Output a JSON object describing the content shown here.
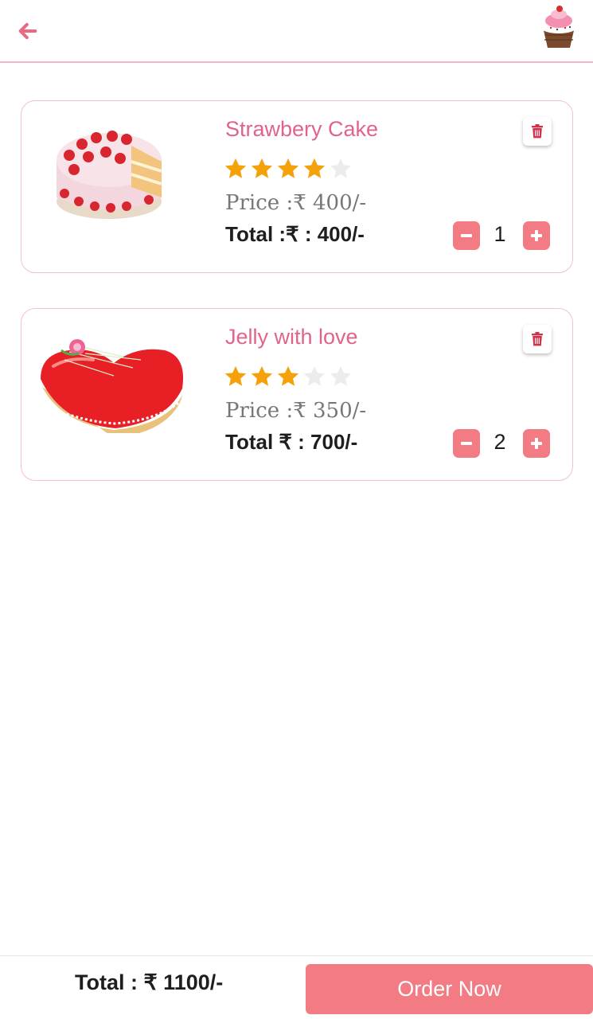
{
  "header": {
    "back_icon": "arrow-left-icon",
    "logo_icon": "cupcake-logo"
  },
  "cart": {
    "items": [
      {
        "name": "Strawbery Cake",
        "rating": 4,
        "max_rating": 5,
        "price_label": "Price :₹ 400/-",
        "total_label": "Total :₹ : 400/-",
        "quantity": "1",
        "image_icon": "strawberry-cake-image"
      },
      {
        "name": "Jelly with love",
        "rating": 3,
        "max_rating": 5,
        "price_label": "Price :₹ 350/-",
        "total_label": "Total ₹ : 700/-",
        "quantity": "2",
        "image_icon": "heart-jelly-cake-image"
      }
    ]
  },
  "footer": {
    "total_label": "Total :  ₹ 1100/-",
    "order_label": "Order Now"
  },
  "colors": {
    "accent": "#f27b84",
    "title": "#e0648a",
    "star_filled": "#f5a20a",
    "star_empty": "#ececec",
    "card_border": "#f3c2cc"
  }
}
